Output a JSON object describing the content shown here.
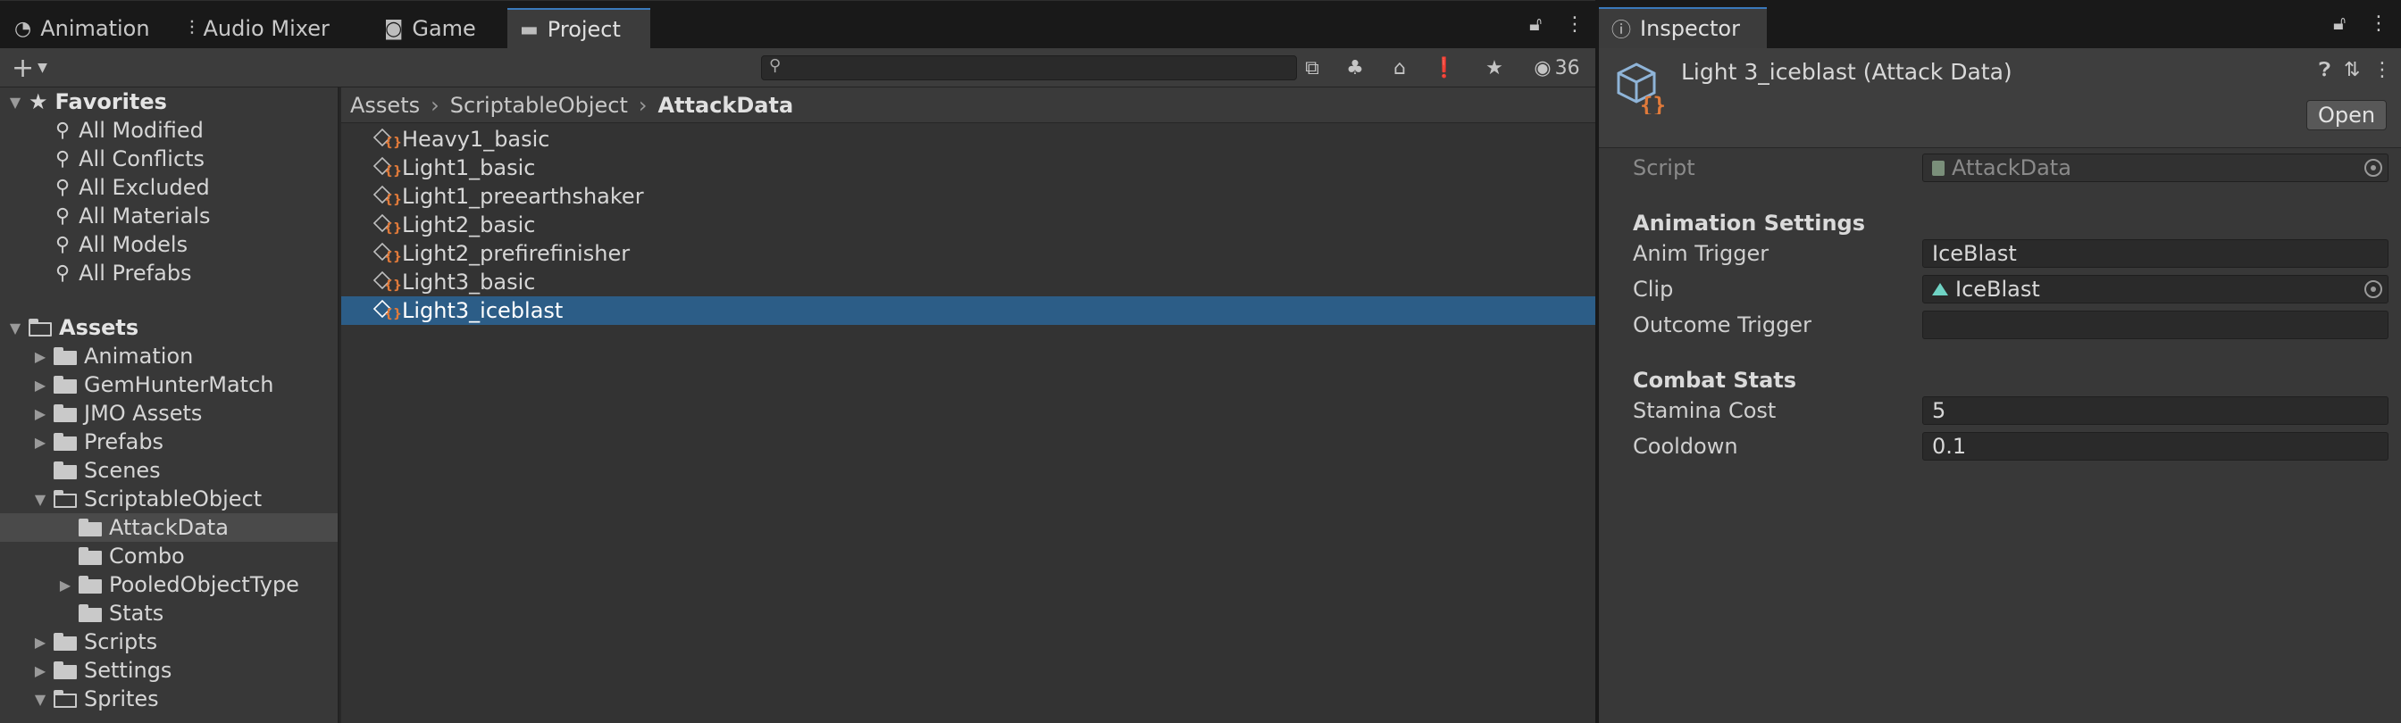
{
  "tabs": {
    "animation": "Animation",
    "audio_mixer": "Audio Mixer",
    "game": "Game",
    "project": "Project",
    "inspector": "Inspector"
  },
  "toolbar": {
    "add_label": "+",
    "search_value": "",
    "hidden_count": "36"
  },
  "favorites": {
    "label": "Favorites",
    "items": [
      "All Modified",
      "All Conflicts",
      "All Excluded",
      "All Materials",
      "All Models",
      "All Prefabs"
    ]
  },
  "assets_tree": {
    "root": "Assets",
    "items": [
      {
        "label": "Animation",
        "expanded": false
      },
      {
        "label": "GemHunterMatch",
        "expanded": false
      },
      {
        "label": "JMO Assets",
        "expanded": false
      },
      {
        "label": "Prefabs",
        "expanded": false
      },
      {
        "label": "Scenes",
        "expanded": null
      },
      {
        "label": "ScriptableObject",
        "expanded": true
      },
      {
        "label": "AttackData",
        "expanded": null,
        "selected": true
      },
      {
        "label": "Combo",
        "expanded": null
      },
      {
        "label": "PooledObjectType",
        "expanded": false
      },
      {
        "label": "Stats",
        "expanded": null
      },
      {
        "label": "Scripts",
        "expanded": false
      },
      {
        "label": "Settings",
        "expanded": false
      },
      {
        "label": "Sprites",
        "expanded": true
      }
    ]
  },
  "breadcrumb": [
    "Assets",
    "ScriptableObject",
    "AttackData"
  ],
  "asset_list": [
    "Heavy1_basic",
    "Light1_basic",
    "Light1_preearthshaker",
    "Light2_basic",
    "Light2_prefirefinisher",
    "Light3_basic",
    "Light3_iceblast"
  ],
  "selected_asset": "Light3_iceblast",
  "inspector": {
    "title": "Light 3_iceblast (Attack Data)",
    "open_label": "Open",
    "script_label": "Script",
    "script_value": "AttackData",
    "section_animation": "Animation Settings",
    "anim_trigger_label": "Anim Trigger",
    "anim_trigger_value": "IceBlast",
    "clip_label": "Clip",
    "clip_value": "IceBlast",
    "outcome_trigger_label": "Outcome Trigger",
    "outcome_trigger_value": "",
    "section_combat": "Combat Stats",
    "stamina_cost_label": "Stamina Cost",
    "stamina_cost_value": "5",
    "cooldown_label": "Cooldown",
    "cooldown_value": "0.1"
  },
  "colors": {
    "selection": "#2c5d87",
    "active_tab_accent": "#3a79bb",
    "scriptable_icon_accent": "#e07a3a"
  }
}
